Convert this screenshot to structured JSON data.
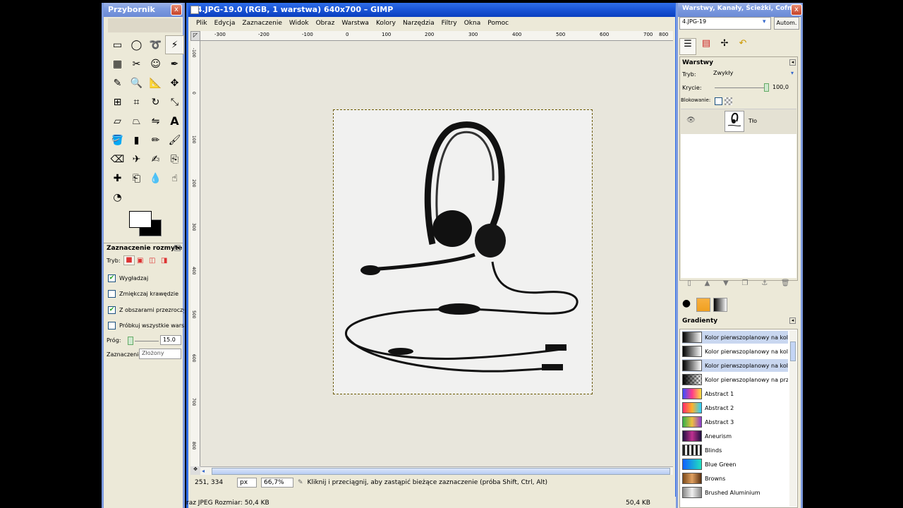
{
  "toolbox": {
    "title": "Przybornik",
    "close": "x",
    "pane_title": "Zaznaczenie rozmyte",
    "mode_label": "Tryb:",
    "options": [
      {
        "label": "Wygładzaj",
        "checked": true
      },
      {
        "label": "Zmiękczaj krawędzie",
        "checked": false
      },
      {
        "label": "Z obszarami przezroczystymi",
        "checked": true
      },
      {
        "label": "Próbkuj wszystkie warstwy",
        "checked": false
      }
    ],
    "threshold_label": "Próg:",
    "threshold_value": "15.0",
    "select_label": "Zaznaczenie:",
    "select_value": "Złożony"
  },
  "image_window": {
    "title": "*4.JPG-19.0 (RGB, 1 warstwa) 640x700 – GIMP",
    "menu": [
      "Plik",
      "Edycja",
      "Zaznaczenie",
      "Widok",
      "Obraz",
      "Warstwa",
      "Kolory",
      "Narzędzia",
      "Filtry",
      "Okna",
      "Pomoc"
    ],
    "ruler_h": [
      "-300",
      "-200",
      "-100",
      "0",
      "100",
      "200",
      "300",
      "400",
      "500",
      "600",
      "700",
      "800"
    ],
    "ruler_v": [
      "-100",
      "0",
      "100",
      "200",
      "300",
      "400",
      "500",
      "600",
      "700",
      "800"
    ],
    "coords": "251, 334",
    "unit": "px",
    "zoom": "66,7%",
    "hint": "Kliknij i przeciągnij, aby zastąpić bieżące zaznaczenie (próba Shift, Ctrl, Alt)",
    "bottom_left": "raz JPEG Rozmiar: 50,4 KB",
    "bottom_right": "50,4 KB"
  },
  "dock": {
    "title": "Warstwy, Kanały, Ścieżki, Cofni...",
    "image_select": "4.JPG-19",
    "auto_button": "Autom.",
    "layers_title": "Warstwy",
    "mode_label": "Tryb:",
    "mode_value": "Zwykły",
    "opacity_label": "Krycie:",
    "opacity_value": "100,0",
    "lock_label": "Blokowanie:",
    "layer_name": "Tło",
    "gradients_title": "Gradienty",
    "gradients": [
      {
        "name": "Kolor pierwszoplanowy na kolor tła (RGB)",
        "colors": [
          "#000000",
          "#ffffff"
        ]
      },
      {
        "name": "Kolor pierwszoplanowy na kolor tła (HSV)",
        "colors": [
          "#000000",
          "#ffffff"
        ]
      },
      {
        "name": "Kolor pierwszoplanowy na kolor tła",
        "colors": [
          "#000000",
          "#ffffff"
        ]
      },
      {
        "name": "Kolor pierwszoplanowy na przezroczystość",
        "colors": [
          "#000000",
          "#cccccc"
        ]
      },
      {
        "name": "Abstract 1",
        "colors": [
          "#3a4cff",
          "#ff3a8a"
        ]
      },
      {
        "name": "Abstract 2",
        "colors": [
          "#ff2a6a",
          "#2ad0ff"
        ]
      },
      {
        "name": "Abstract 3",
        "colors": [
          "#35b04a",
          "#f0c040"
        ]
      },
      {
        "name": "Aneurism",
        "colors": [
          "#201040",
          "#c03090"
        ]
      },
      {
        "name": "Blinds",
        "colors": [
          "#222222",
          "#eeeeee"
        ]
      },
      {
        "name": "Blue Green",
        "colors": [
          "#1060ff",
          "#20e0c0"
        ]
      },
      {
        "name": "Browns",
        "colors": [
          "#7a4a1a",
          "#e0a060"
        ]
      },
      {
        "name": "Brushed Aluminium",
        "colors": [
          "#888888",
          "#f0f0f0"
        ]
      }
    ]
  }
}
